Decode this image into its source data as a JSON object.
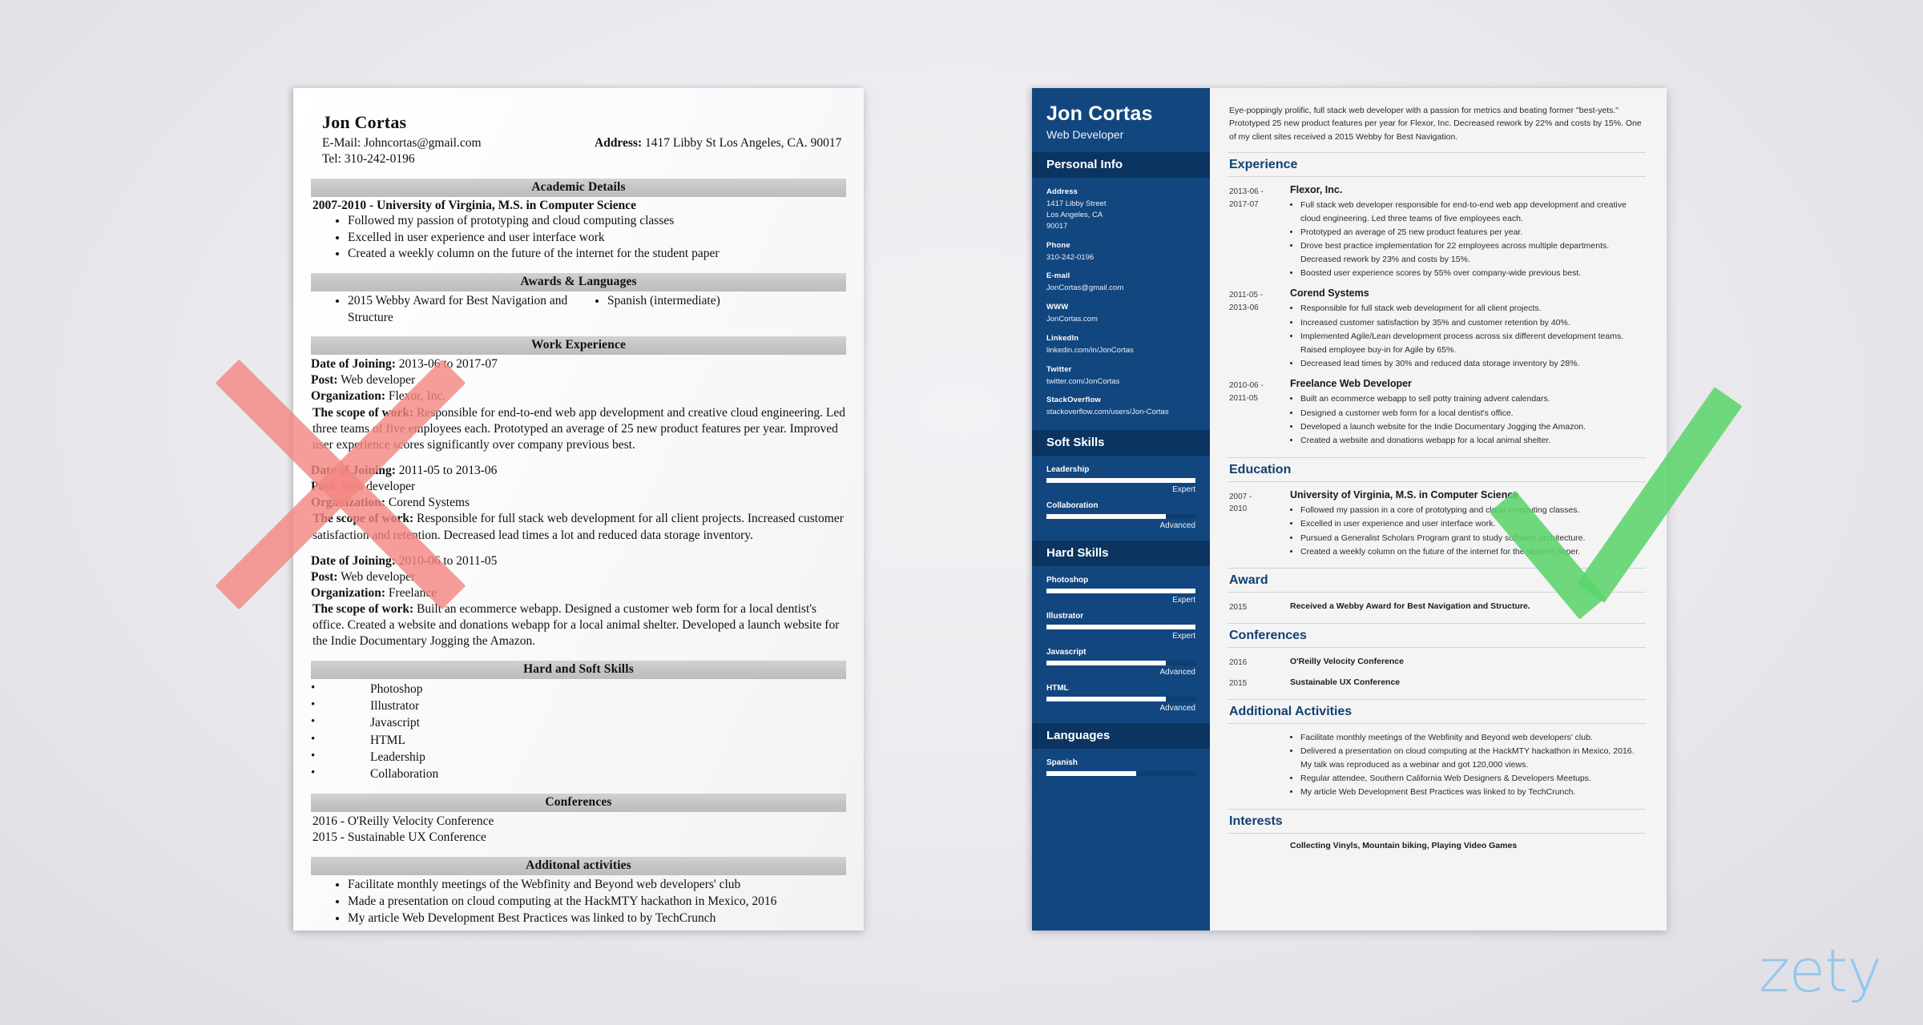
{
  "bad_resume": {
    "name": "Jon Cortas",
    "email_label": "E-Mail:",
    "email": "Johncortas@gmail.com",
    "tel_label": "Tel:",
    "tel": "310-242-0196",
    "address_label": "Address:",
    "address": "1417 Libby St Los Angeles, CA. 90017",
    "sections": {
      "academic": {
        "title": "Academic Details",
        "heading": "2007-2010 - University of Virginia, M.S. in Computer Science",
        "bullets": [
          "Followed my passion of prototyping and cloud computing classes",
          "Excelled in user experience and user interface work",
          "Created a weekly column on the future of the internet for the student paper"
        ]
      },
      "awards": {
        "title": "Awards & Languages",
        "left": [
          "2015 Webby Award for Best Navigation and Structure"
        ],
        "right": [
          "Spanish (intermediate)"
        ]
      },
      "work": {
        "title": "Work Experience",
        "label_date": "Date of Joining:",
        "label_post": "Post:",
        "label_org": "Organization:",
        "label_scope": "The scope of work:",
        "jobs": [
          {
            "date": "2013-06 to 2017-07",
            "post": "Web developer",
            "org": "Flexor, Inc.",
            "scope": "Responsible for end-to-end web app development and creative cloud engineering. Led three teams of five employees each. Prototyped an average of 25 new product features per year. Improved user experience scores significantly over company previous best."
          },
          {
            "date": "2011-05 to 2013-06",
            "post": "Web developer",
            "org": "Corend Systems",
            "scope": "Responsible for full stack web development for all client projects. Increased customer satisfaction and retention. Decreased lead times a lot and reduced data storage inventory."
          },
          {
            "date": "2010-06 to 2011-05",
            "post": "Web developer",
            "org": " Freelance",
            "scope": "Built an ecommerce webapp. Designed a customer web form for a local dentist's office. Created a website and donations webapp for a local animal shelter. Developed a launch website for the Indie Documentary Jogging the Amazon."
          }
        ]
      },
      "skills": {
        "title": "Hard and Soft Skills",
        "items": [
          "Photoshop",
          "Illustrator",
          "Javascript",
          "HTML",
          "Leadership",
          "Collaboration"
        ]
      },
      "conferences": {
        "title": "Conferences",
        "lines": [
          "2016 - O'Reilly Velocity Conference",
          "2015 - Sustainable UX Conference"
        ]
      },
      "additional": {
        "title": "Additonal activities",
        "bullets": [
          "Facilitate monthly meetings of the Webfinity and Beyond web developers' club",
          "Made a presentation on cloud computing at the HackMTY hackathon in Mexico, 2016",
          "My article Web Development Best Practices was linked to by TechCrunch"
        ]
      }
    }
  },
  "good_resume": {
    "sidebar": {
      "name": "Jon Cortas",
      "role": "Web Developer",
      "personal_info_title": "Personal Info",
      "fields": [
        {
          "label": "Address",
          "value": "1417 Libby Street\nLos Angeles, CA\n90017"
        },
        {
          "label": "Phone",
          "value": "310-242-0196"
        },
        {
          "label": "E-mail",
          "value": "JonCortas@gmail.com"
        },
        {
          "label": "WWW",
          "value": "JonCortas.com"
        },
        {
          "label": "LinkedIn",
          "value": "linkedin.com/in/JonCortas"
        },
        {
          "label": "Twitter",
          "value": "twitter.com/JonCortas"
        },
        {
          "label": "StackOverflow",
          "value": "stackoverflow.com/users/Jon-Cortas"
        }
      ],
      "soft_skills_title": "Soft Skills",
      "soft_skills": [
        {
          "name": "Leadership",
          "level": "Expert",
          "percent": 100
        },
        {
          "name": "Collaboration",
          "level": "Advanced",
          "percent": 80
        }
      ],
      "hard_skills_title": "Hard Skills",
      "hard_skills": [
        {
          "name": "Photoshop",
          "level": "Expert",
          "percent": 100
        },
        {
          "name": "Illustrator",
          "level": "Expert",
          "percent": 100
        },
        {
          "name": "Javascript",
          "level": "Advanced",
          "percent": 80
        },
        {
          "name": "HTML",
          "level": "Advanced",
          "percent": 80
        }
      ],
      "languages_title": "Languages",
      "languages": [
        {
          "name": "Spanish",
          "level": "",
          "percent": 60
        }
      ]
    },
    "main": {
      "summary": "Eye-poppingly prolific, full stack web developer with a passion for metrics and beating former \"best-yets.\" Prototyped 25 new product features per year for Flexor, Inc. Decreased rework by 22% and costs by 15%. One of my client sites received a 2015 Webby for Best Navigation.",
      "experience_title": "Experience",
      "experience": [
        {
          "dates": "2013-06 -\n2017-07",
          "org": "Flexor, Inc.",
          "bullets": [
            "Full stack web developer responsible for end-to-end web app development and creative cloud engineering. Led three teams of five employees each.",
            "Prototyped an average of 25 new product features per year.",
            "Drove best practice implementation for 22 employees across multiple departments. Decreased rework by 23% and costs by 15%.",
            "Boosted user experience scores by 55% over company-wide previous best."
          ]
        },
        {
          "dates": "2011-05 -\n2013-06",
          "org": "Corend Systems",
          "bullets": [
            "Responsible for full stack web development for all client projects.",
            "Increased customer satisfaction by 35% and customer retention by 40%.",
            "Implemented Agile/Lean development process across six different development teams. Raised employee buy-in for Agile by 65%.",
            "Decreased lead times by 30% and reduced data storage inventory by 28%."
          ]
        },
        {
          "dates": "2010-06 -\n2011-05",
          "org": "Freelance Web Developer",
          "bullets": [
            "Built an ecommerce webapp to sell potty training advent calendars.",
            "Designed a customer web form for a local dentist's office.",
            "Developed a launch website for the Indie Documentary Jogging the Amazon.",
            "Created a website and donations webapp for a local animal shelter."
          ]
        }
      ],
      "education_title": "Education",
      "education": [
        {
          "dates": "2007 -\n2010",
          "org": "University of Virginia, M.S. in Computer Science",
          "bullets": [
            "Followed my passion in a core of prototyping and cloud computing classes.",
            "Excelled in user experience and user interface work.",
            "Pursued a Generalist Scholars Program grant to study software architecture.",
            "Created a weekly column on the future of the internet for the student paper."
          ]
        }
      ],
      "award_title": "Award",
      "awards": [
        {
          "dates": "2015",
          "text": "Received a Webby Award for Best Navigation and Structure."
        }
      ],
      "conferences_title": "Conferences",
      "conferences": [
        {
          "dates": "2016",
          "text": "O'Reilly Velocity Conference"
        },
        {
          "dates": "2015",
          "text": "Sustainable UX Conference"
        }
      ],
      "additional_title": "Additional Activities",
      "additional": [
        "Facilitate monthly meetings of the Webfinity and Beyond web developers' club.",
        "Delivered a presentation on cloud computing at the HackMTY hackathon in Mexico, 2016. My talk was reproduced as a webinar and got 120,000 views.",
        "Regular attendee, Southern California Web Designers & Developers Meetups.",
        "My article Web Development Best Practices was linked to by TechCrunch."
      ],
      "interests_title": "Interests",
      "interests": "Collecting Vinyls, Mountain biking, Playing Video Games"
    }
  },
  "overlays": {
    "reject_mark": "x-mark",
    "approve_mark": "check-mark",
    "reject_color": "#f4847f",
    "approve_color": "#5cd46c"
  },
  "watermark": {
    "text": "zety",
    "color": "#8ec5ef"
  }
}
